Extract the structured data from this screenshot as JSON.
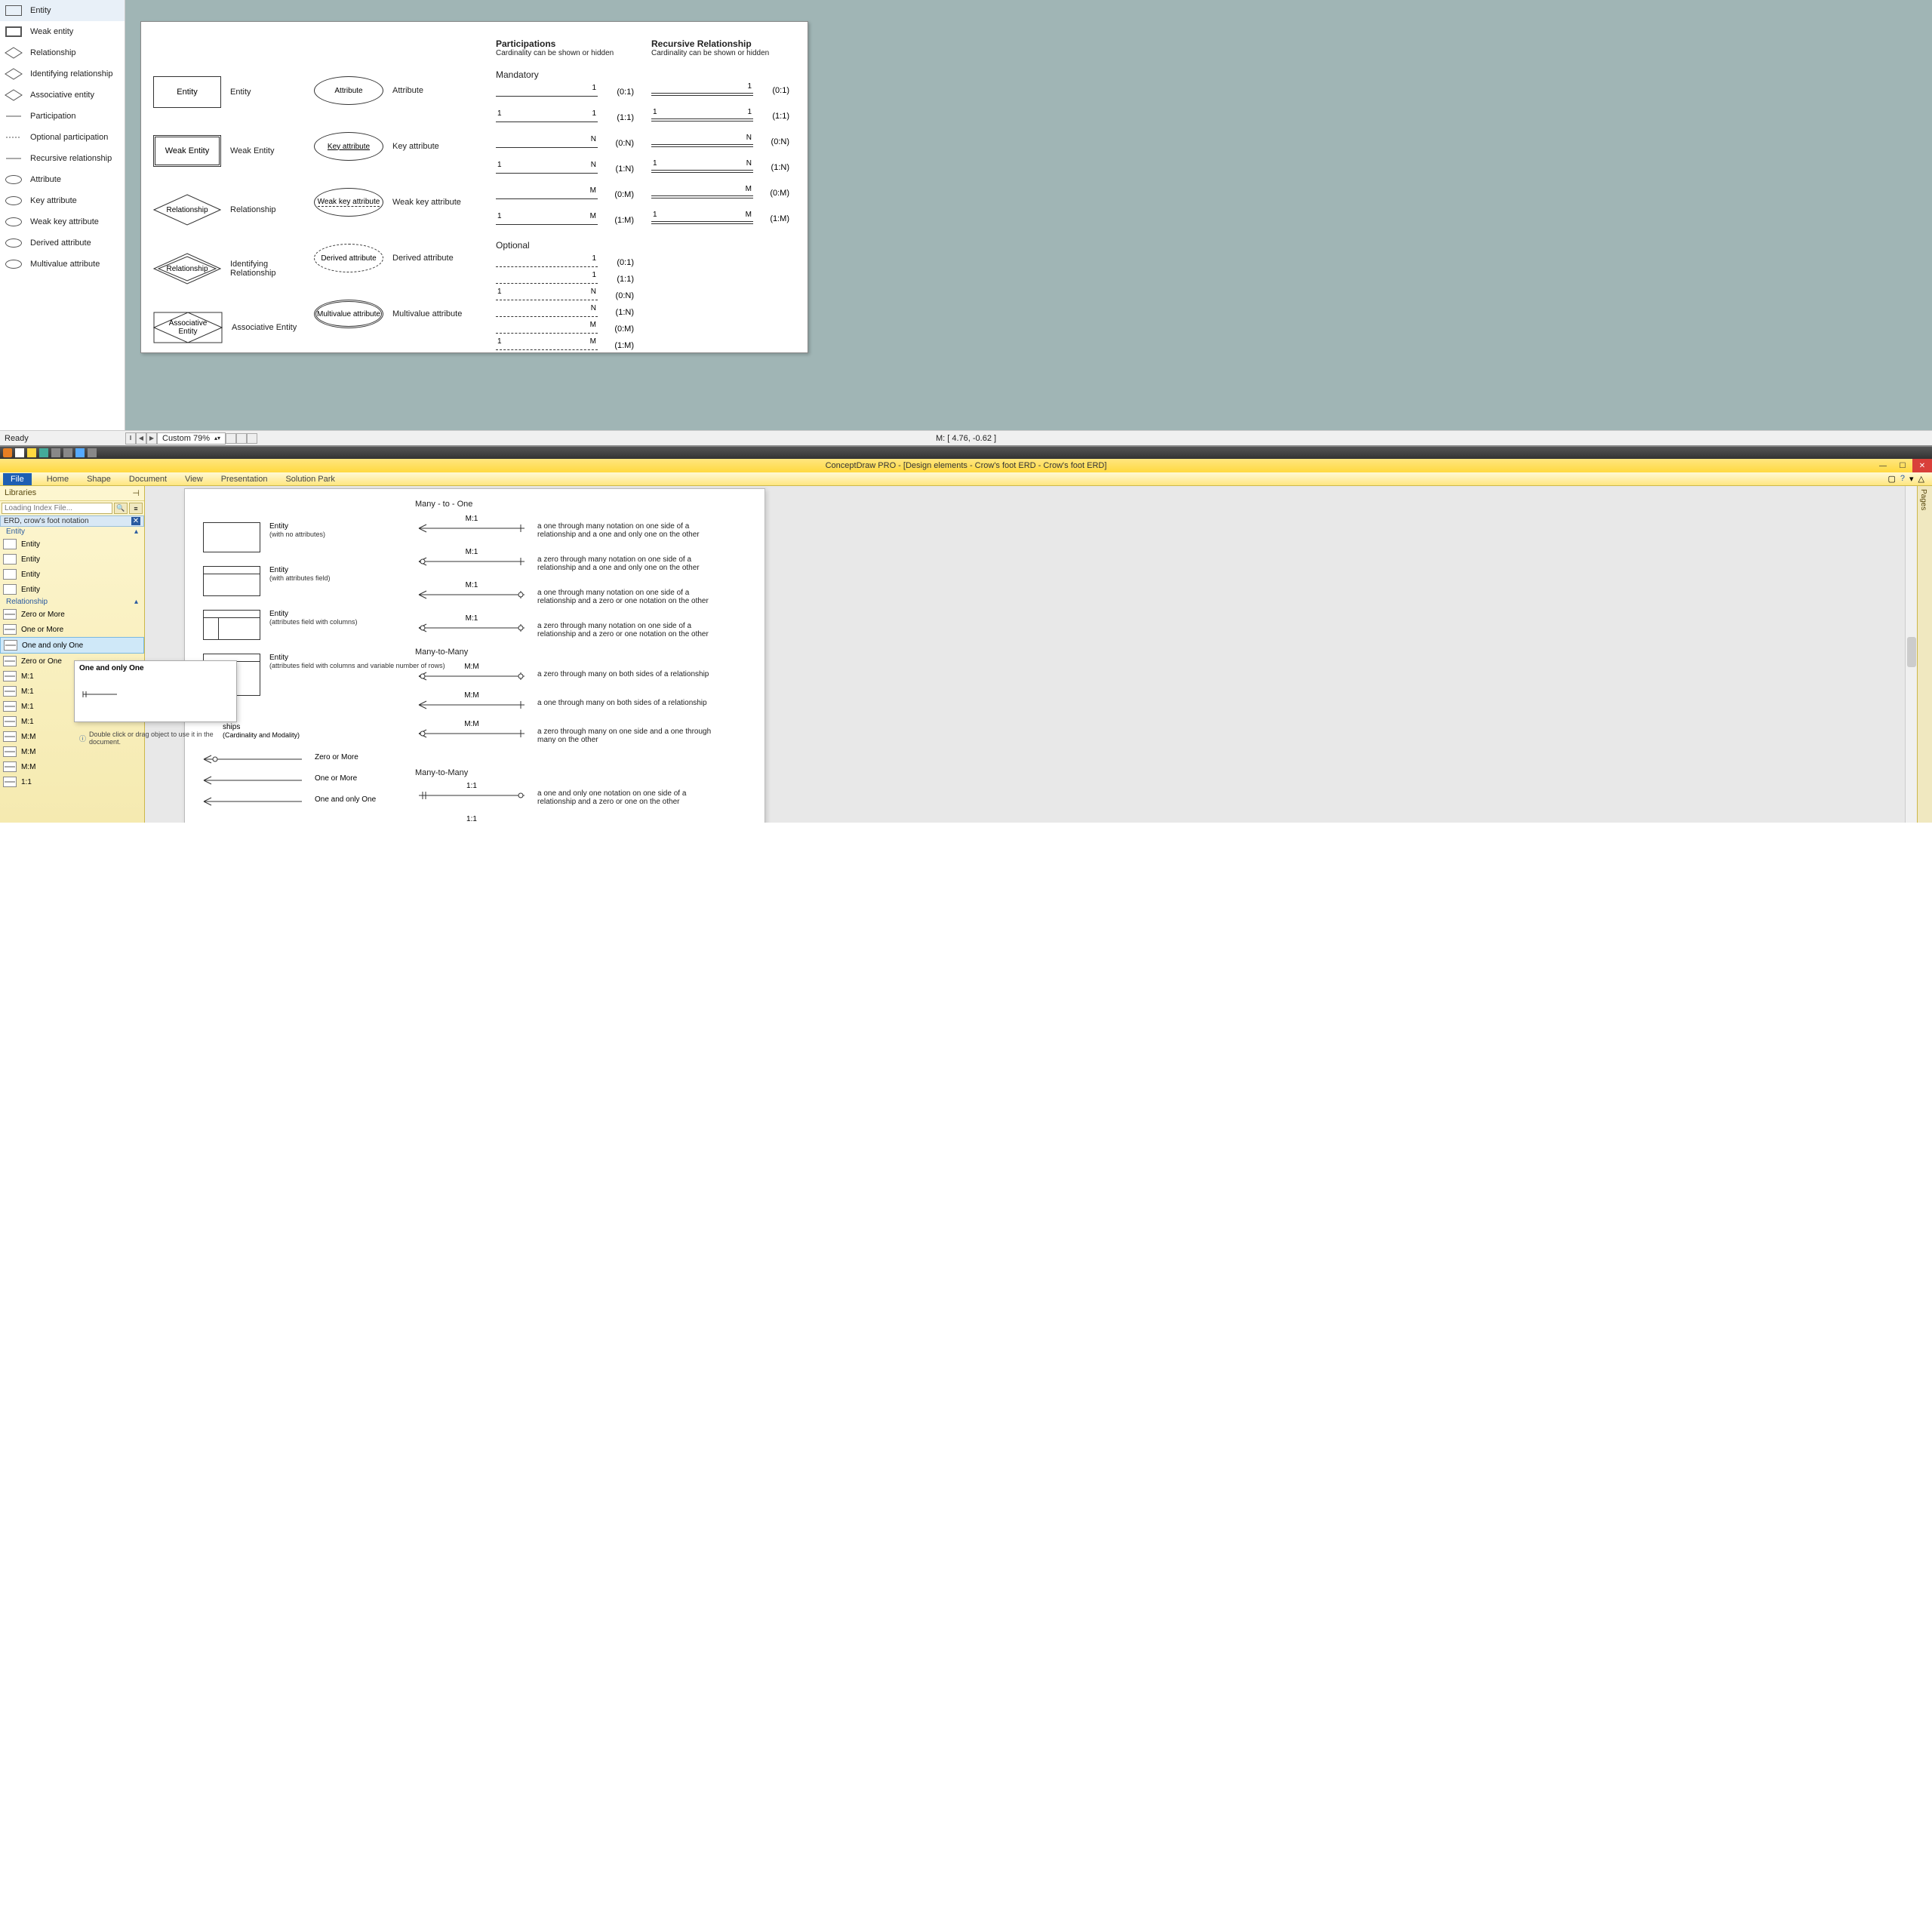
{
  "upper": {
    "palette": [
      {
        "label": "Entity",
        "icon": "rect"
      },
      {
        "label": "Weak entity",
        "icon": "dbl-rect"
      },
      {
        "label": "Relationship",
        "icon": "diamond"
      },
      {
        "label": "Identifying relationship",
        "icon": "dbl-diamond"
      },
      {
        "label": "Associative entity",
        "icon": "assoc"
      },
      {
        "label": "Participation",
        "icon": "line"
      },
      {
        "label": "Optional participation",
        "icon": "dash-line"
      },
      {
        "label": "Recursive relationship",
        "icon": "dbl-line"
      },
      {
        "label": "Attribute",
        "icon": "ellipse"
      },
      {
        "label": "Key attribute",
        "icon": "ellipse-key"
      },
      {
        "label": "Weak key attribute",
        "icon": "ellipse-weak"
      },
      {
        "label": "Derived attribute",
        "icon": "ellipse-dash"
      },
      {
        "label": "Multivalue attribute",
        "icon": "ellipse-dbl"
      }
    ],
    "status_ready": "Ready",
    "zoom": "Custom 79%",
    "status_coord": "M: [ 4.76, -0.62 ]",
    "canvas": {
      "col1": [
        {
          "shape": "entity",
          "text": "Entity",
          "label": "Entity"
        },
        {
          "shape": "weak",
          "text": "Weak Entity",
          "label": "Weak Entity"
        },
        {
          "shape": "diamond",
          "text": "Relationship",
          "label": "Relationship"
        },
        {
          "shape": "dbl-diamond",
          "text": "Relationship",
          "label": "Identifying Relationship"
        },
        {
          "shape": "assoc",
          "text": "Associative\nEntity",
          "label": "Associative Entity"
        }
      ],
      "col2": [
        {
          "shape": "ellipse",
          "text": "Attribute",
          "label": "Attribute"
        },
        {
          "shape": "ellipse-key",
          "text": "Key attribute",
          "label": "Key attribute"
        },
        {
          "shape": "ellipse-weakkey",
          "text": "Weak key attribute",
          "label": "Weak key attribute"
        },
        {
          "shape": "ellipse-dash",
          "text": "Derived attribute",
          "label": "Derived attribute"
        },
        {
          "shape": "ellipse-dbl",
          "text": "Multivalue attribute",
          "label": "Multivalue attribute"
        }
      ],
      "participations": {
        "title": "Participations",
        "subtitle": "Cardinality can be shown or hidden",
        "mandatory_label": "Mandatory",
        "mandatory": [
          {
            "l": "",
            "r": "1",
            "card": "(0:1)",
            "style": "sgl"
          },
          {
            "l": "1",
            "r": "1",
            "card": "(1:1)",
            "style": "sgl"
          },
          {
            "l": "",
            "r": "N",
            "card": "(0:N)",
            "style": "sgl"
          },
          {
            "l": "1",
            "r": "N",
            "card": "(1:N)",
            "style": "sgl"
          },
          {
            "l": "",
            "r": "M",
            "card": "(0:M)",
            "style": "sgl"
          },
          {
            "l": "1",
            "r": "M",
            "card": "(1:M)",
            "style": "sgl"
          }
        ],
        "optional_label": "Optional",
        "optional": [
          {
            "l": "",
            "r": "1",
            "card": "(0:1)",
            "style": "dsh"
          },
          {
            "l": "",
            "r": "1",
            "card": "(1:1)",
            "style": "dsh"
          },
          {
            "l": "1",
            "r": "N",
            "card": "(0:N)",
            "style": "dsh"
          },
          {
            "l": "",
            "r": "N",
            "card": "(1:N)",
            "style": "dsh"
          },
          {
            "l": "",
            "r": "M",
            "card": "(0:M)",
            "style": "dsh"
          },
          {
            "l": "1",
            "r": "M",
            "card": "(1:M)",
            "style": "dsh"
          }
        ]
      },
      "recursive": {
        "title": "Recursive Relationship",
        "subtitle": "Cardinality can be shown or hidden",
        "lines": [
          {
            "l": "",
            "r": "1",
            "card": "(0:1)"
          },
          {
            "l": "1",
            "r": "1",
            "card": "(1:1)"
          },
          {
            "l": "",
            "r": "N",
            "card": "(0:N)"
          },
          {
            "l": "1",
            "r": "N",
            "card": "(1:N)"
          },
          {
            "l": "",
            "r": "M",
            "card": "(0:M)"
          },
          {
            "l": "1",
            "r": "M",
            "card": "(1:M)"
          }
        ]
      }
    }
  },
  "lower": {
    "title": "ConceptDraw PRO - [Design elements - Crow's foot ERD - Crow's foot ERD]",
    "ribbon": {
      "file": "File",
      "tabs": [
        "Home",
        "Shape",
        "Document",
        "View",
        "Presentation",
        "Solution Park"
      ]
    },
    "libraries": {
      "header": "Libraries",
      "search_placeholder": "Loading Index File...",
      "library_name": "ERD, crow's foot notation",
      "group_entity": "Entity",
      "entities": [
        "Entity",
        "Entity",
        "Entity",
        "Entity"
      ],
      "group_relationship": "Relationship",
      "relationships": [
        "Zero or More",
        "One or More",
        "One and only One",
        "Zero or One",
        "M:1",
        "M:1",
        "M:1",
        "M:1",
        "M:M",
        "M:M",
        "M:M",
        "1:1"
      ],
      "selected_index": 2
    },
    "tooltip": {
      "title": "One and only One",
      "hint": "Double click or drag object to use it in the document."
    },
    "pages_tab": "Pages",
    "canvas": {
      "section1": "Many - to - One",
      "entities": [
        {
          "name": "Entity",
          "sub": "(with no attributes)",
          "box": "plain"
        },
        {
          "name": "Entity",
          "sub": "(with attributes field)",
          "box": "header"
        },
        {
          "name": "Entity",
          "sub": "(attributes field with columns)",
          "box": "header-cols"
        },
        {
          "name": "Entity",
          "sub": "(attributes field with columns and variable number of rows)",
          "box": "header-rows"
        }
      ],
      "m1_rels": [
        {
          "lbl": "M:1",
          "desc": "a one through many notation on one side of a relationship and a one and only one on the other"
        },
        {
          "lbl": "M:1",
          "desc": "a zero through many notation on one side of a relationship and a one and only one on the other"
        },
        {
          "lbl": "M:1",
          "desc": "a one through many notation on one side of a relationship and a zero or one notation on the other"
        },
        {
          "lbl": "M:1",
          "desc": "a zero through many notation on one side of a relationship and a zero or one notation on the other"
        }
      ],
      "section2": "Many-to-Many",
      "mm_rels": [
        {
          "lbl": "M:M",
          "desc": "a zero through many on both sides of a relationship"
        },
        {
          "lbl": "M:M",
          "desc": "a one through many on both sides of a relationship"
        },
        {
          "lbl": "M:M",
          "desc": "a zero through many on one side and a one through many on the other"
        }
      ],
      "relships_header": "ships",
      "relships_sub": "(Cardinality and Modality)",
      "simple_rels": [
        {
          "lbl": "Zero or More"
        },
        {
          "lbl": "One or More"
        },
        {
          "lbl": "One and only One"
        }
      ],
      "section3": "Many-to-Many",
      "one_rels": [
        {
          "lbl": "1:1",
          "desc": "a one and only one notation on one side of a relationship and a zero or one on the other"
        },
        {
          "lbl": "1:1",
          "desc": ""
        }
      ]
    }
  }
}
